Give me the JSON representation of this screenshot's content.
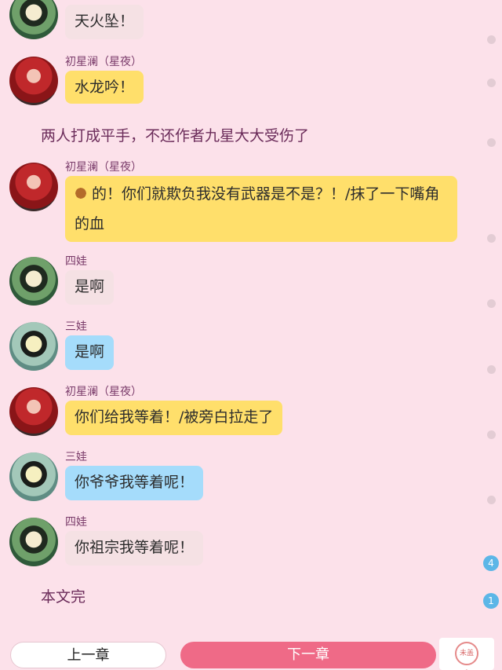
{
  "messages": [
    {
      "type": "chat",
      "avatar": "girl-green-icon",
      "name": "",
      "text": "天火坠！",
      "color": "grey"
    },
    {
      "type": "chat",
      "avatar": "red-hood-icon",
      "name": "初星澜（星夜）",
      "text": "水龙吟！",
      "color": "yellow"
    },
    {
      "type": "narration",
      "text": "两人打成平手，不还作者九星大大受伤了"
    },
    {
      "type": "chat",
      "avatar": "red-hood-icon",
      "name": "初星澜（星夜）",
      "text_line1": "的！你们就欺负我没有武器是不是？！/抹了一下嘴角",
      "text_line2": "的血",
      "color": "yellow",
      "emoji": "horse-emoji-icon"
    },
    {
      "type": "chat",
      "avatar": "girl-green-icon",
      "name": "四娃",
      "text": "是啊",
      "color": "grey"
    },
    {
      "type": "chat",
      "avatar": "girl-teal-icon",
      "name": "三娃",
      "text": "是啊",
      "color": "blue"
    },
    {
      "type": "chat",
      "avatar": "red-hood-icon",
      "name": "初星澜（星夜）",
      "text": "你们给我等着！/被旁白拉走了",
      "color": "yellow"
    },
    {
      "type": "chat",
      "avatar": "girl-teal-icon",
      "name": "三娃",
      "text": "你爷爷我等着呢！",
      "color": "blue"
    },
    {
      "type": "chat",
      "avatar": "girl-green-icon",
      "name": "四娃",
      "text": "你祖宗我等着呢！",
      "color": "grey"
    },
    {
      "type": "narration",
      "text": "本文完"
    }
  ],
  "badges": [
    "4",
    "1"
  ],
  "footer": {
    "prev_label": "上一章",
    "next_label": "下一章",
    "stamp_text": "未盖章"
  }
}
